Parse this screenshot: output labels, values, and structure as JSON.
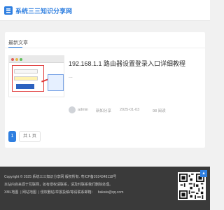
{
  "header": {
    "site_title": "系统三三知识分享网"
  },
  "main": {
    "tab_label": "最新文章",
    "post": {
      "title": "192.168.1.1 路由器设置登录入口详细教程",
      "excerpt": "...",
      "author": "admin",
      "category": "新知分享",
      "date": "2025-01-03",
      "views": "98 阅读"
    },
    "pagination": {
      "current_page": "1",
      "total_label": "共 1 页"
    }
  },
  "footer": {
    "copyright": "Copyright © 2025 系统三三知识分享网 版权所有. 粤ICP备2024348118号",
    "notice": "本站内容来源于互联网，如有侵权请联系，请及时联系我们删除处理。",
    "links": [
      "XML地图",
      "网站地图",
      "侵权删帖/举报投稿/等请联系邮箱：",
      "bakata@qq.com"
    ]
  },
  "colors": {
    "accent": "#2f7fe0",
    "footer_bg": "#3a3a3a",
    "page_bg": "#f1f1f1"
  }
}
